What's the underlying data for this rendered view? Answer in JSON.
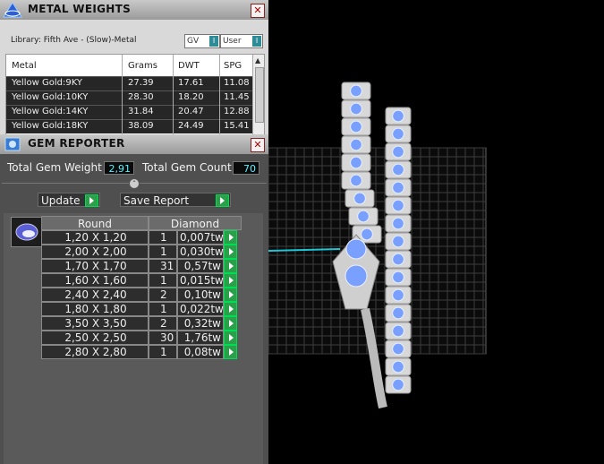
{
  "metal_weights": {
    "title": "METAL WEIGHTS",
    "close": "✕",
    "library": "Library: Fifth Ave - (Slow)-Metal",
    "gv_label": "GV",
    "user_label": "User",
    "columns": [
      "Metal",
      "Grams",
      "DWT",
      "SPG"
    ],
    "rows": [
      {
        "metal": "Yellow Gold:9KY",
        "grams": "27.39",
        "dwt": "17.61",
        "spg": "11.08"
      },
      {
        "metal": "Yellow Gold:10KY",
        "grams": "28.30",
        "dwt": "18.20",
        "spg": "11.45"
      },
      {
        "metal": "Yellow Gold:14KY",
        "grams": "31.84",
        "dwt": "20.47",
        "spg": "12.88"
      },
      {
        "metal": "Yellow Gold:18KY",
        "grams": "38.09",
        "dwt": "24.49",
        "spg": "15.41"
      }
    ]
  },
  "gem_reporter": {
    "title": "GEM REPORTER",
    "close": "✕",
    "total_weight_label": "Total Gem Weight",
    "total_weight_value": "2,91",
    "total_count_label": "Total Gem Count",
    "total_count_value": "70",
    "update_label": "Update",
    "save_report_label": "Save Report",
    "shape_header": "Round",
    "type_header": "Diamond",
    "gems": [
      {
        "size": "1,20 X 1,20",
        "count": "1",
        "weight": "0,007tw"
      },
      {
        "size": "2,00 X 2,00",
        "count": "1",
        "weight": "0,030tw"
      },
      {
        "size": "1,70 X 1,70",
        "count": "31",
        "weight": "0,57tw"
      },
      {
        "size": "1,60 X 1,60",
        "count": "1",
        "weight": "0,015tw"
      },
      {
        "size": "2,40 X 2,40",
        "count": "2",
        "weight": "0,10tw"
      },
      {
        "size": "1,80 X 1,80",
        "count": "1",
        "weight": "0,022tw"
      },
      {
        "size": "3,50 X 3,50",
        "count": "2",
        "weight": "0,32tw"
      },
      {
        "size": "2,50 X 2,50",
        "count": "30",
        "weight": "1,76tw"
      },
      {
        "size": "2,80 X 2,80",
        "count": "1",
        "weight": "0,08tw"
      }
    ]
  },
  "colors": {
    "accent_cyan": "#5cf0ff",
    "go_green": "#2aa04a",
    "gem_blue": "#7aa0ff"
  }
}
